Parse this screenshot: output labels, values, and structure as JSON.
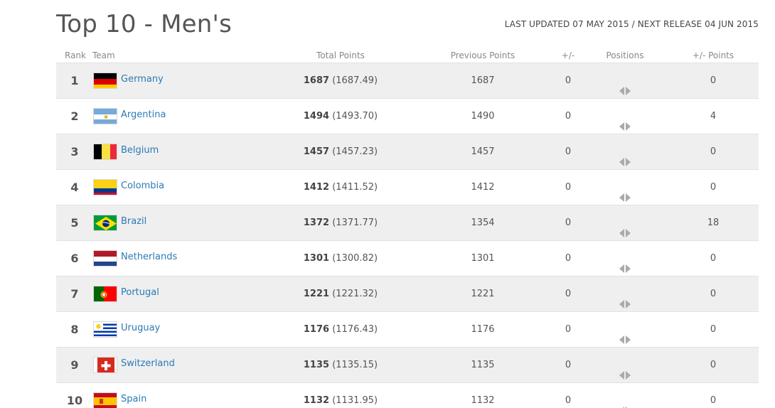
{
  "title": "Top 10 - Men's",
  "updated": "LAST UPDATED 07 MAY 2015 / NEXT RELEASE 04 JUN 2015",
  "headers": {
    "rank": "Rank",
    "team": "Team",
    "total": "Total Points",
    "previous": "Previous Points",
    "plusminus": "+/-",
    "positions": "Positions",
    "plusminus_points": "+/- Points"
  },
  "rows": [
    {
      "rank": "1",
      "team": "Germany",
      "flag": "germany-flag",
      "total_int": "1687",
      "total_dec": "(1687.49)",
      "previous": "1687",
      "plusminus": "0",
      "plusminus_points": "0"
    },
    {
      "rank": "2",
      "team": "Argentina",
      "flag": "argentina-flag",
      "total_int": "1494",
      "total_dec": "(1493.70)",
      "previous": "1490",
      "plusminus": "0",
      "plusminus_points": "4"
    },
    {
      "rank": "3",
      "team": "Belgium",
      "flag": "belgium-flag",
      "total_int": "1457",
      "total_dec": "(1457.23)",
      "previous": "1457",
      "plusminus": "0",
      "plusminus_points": "0"
    },
    {
      "rank": "4",
      "team": "Colombia",
      "flag": "colombia-flag",
      "total_int": "1412",
      "total_dec": "(1411.52)",
      "previous": "1412",
      "plusminus": "0",
      "plusminus_points": "0"
    },
    {
      "rank": "5",
      "team": "Brazil",
      "flag": "brazil-flag",
      "total_int": "1372",
      "total_dec": "(1371.77)",
      "previous": "1354",
      "plusminus": "0",
      "plusminus_points": "18"
    },
    {
      "rank": "6",
      "team": "Netherlands",
      "flag": "netherlands-flag",
      "total_int": "1301",
      "total_dec": "(1300.82)",
      "previous": "1301",
      "plusminus": "0",
      "plusminus_points": "0"
    },
    {
      "rank": "7",
      "team": "Portugal",
      "flag": "portugal-flag",
      "total_int": "1221",
      "total_dec": "(1221.32)",
      "previous": "1221",
      "plusminus": "0",
      "plusminus_points": "0"
    },
    {
      "rank": "8",
      "team": "Uruguay",
      "flag": "uruguay-flag",
      "total_int": "1176",
      "total_dec": "(1176.43)",
      "previous": "1176",
      "plusminus": "0",
      "plusminus_points": "0"
    },
    {
      "rank": "9",
      "team": "Switzerland",
      "flag": "switzerland-flag",
      "total_int": "1135",
      "total_dec": "(1135.15)",
      "previous": "1135",
      "plusminus": "0",
      "plusminus_points": "0"
    },
    {
      "rank": "10",
      "team": "Spain",
      "flag": "spain-flag",
      "total_int": "1132",
      "total_dec": "(1131.95)",
      "previous": "1132",
      "plusminus": "0",
      "plusminus_points": "0"
    }
  ],
  "position_icon": "unchanged-arrows-icon",
  "colors": {
    "link": "#2a7ab8",
    "row_alt": "#efefef",
    "text": "#555555"
  }
}
